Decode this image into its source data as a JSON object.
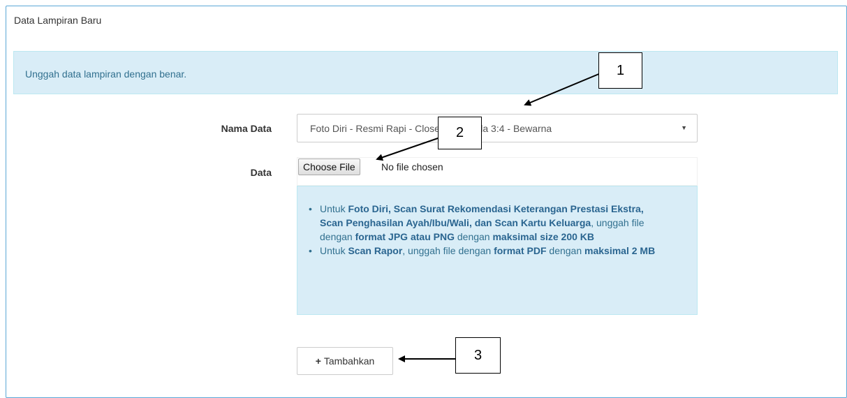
{
  "panel": {
    "title": "Data Lampiran Baru"
  },
  "banner": {
    "text": "Unggah data lampiran dengan benar."
  },
  "form": {
    "nama_label": "Nama Data",
    "nama_value": "Foto Diri - Resmi Rapi - Close Up - Skala 3:4 - Bewarna",
    "data_label": "Data",
    "file_button": "Choose File",
    "file_status": "No file chosen"
  },
  "help": {
    "item1": {
      "t1": "Untuk ",
      "b1": "Foto Diri, Scan Surat Rekomendasi Keterangan Prestasi Ekstra, Scan Penghasilan Ayah/Ibu/Wali, dan Scan Kartu Keluarga",
      "t2": ", unggah file dengan ",
      "b2": "format JPG atau PNG",
      "t3": " dengan ",
      "b3": "maksimal size 200 KB"
    },
    "item2": {
      "t1": "Untuk ",
      "b1": "Scan Rapor",
      "t2": ", unggah file dengan ",
      "b2": "format PDF",
      "t3": " dengan ",
      "b3": "maksimal 2 MB"
    }
  },
  "add_button": {
    "plus": "+",
    "label": "Tambahkan"
  },
  "callouts": [
    "1",
    "2",
    "3"
  ]
}
